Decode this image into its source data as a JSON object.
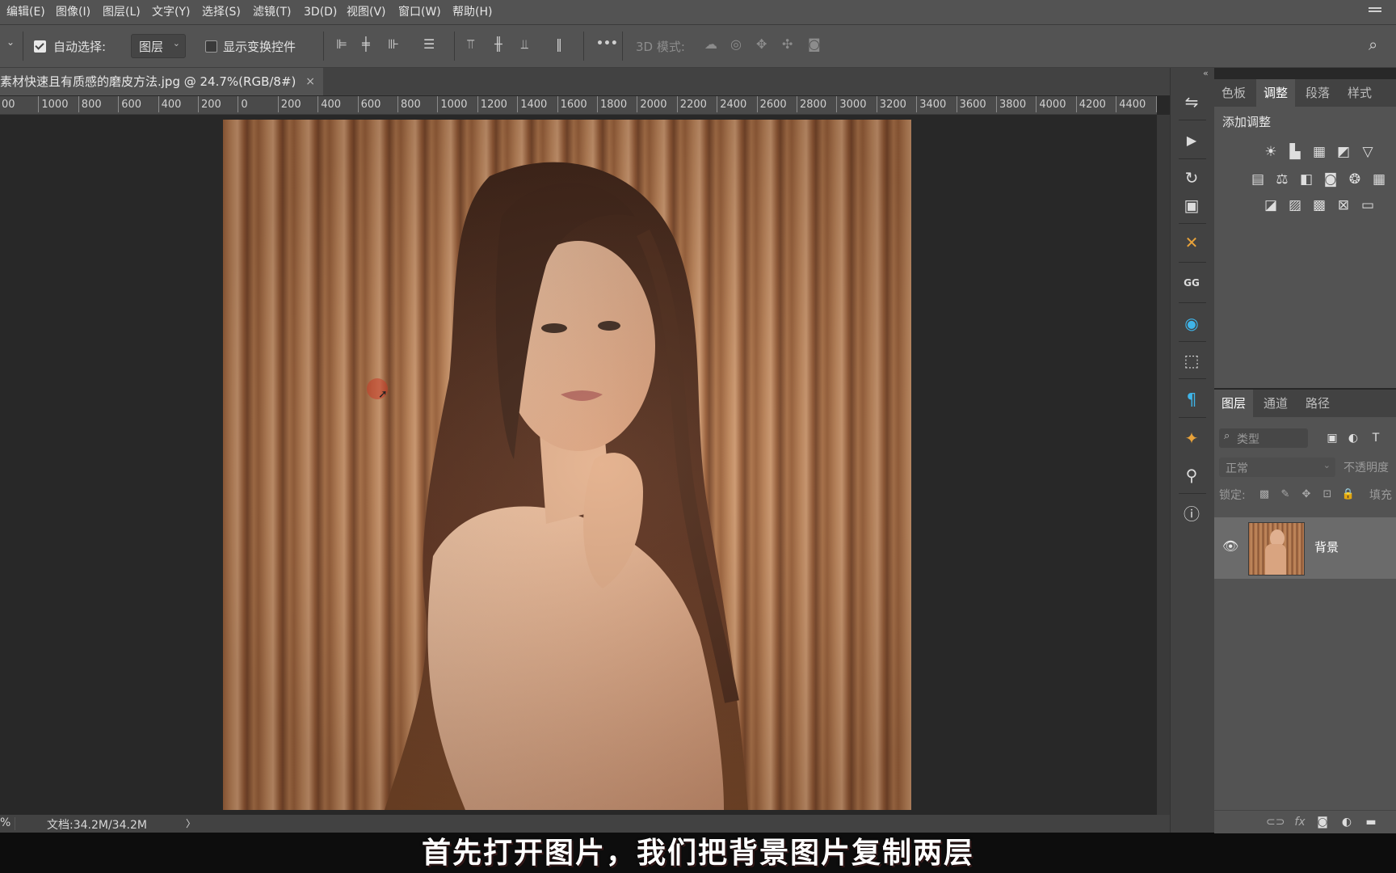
{
  "menu": [
    "编辑(E)",
    "图像(I)",
    "图层(L)",
    "文字(Y)",
    "选择(S)",
    "滤镜(T)",
    "3D(D)",
    "视图(V)",
    "窗口(W)",
    "帮助(H)"
  ],
  "options": {
    "auto_select_label": "自动选择:",
    "auto_select_value": "图层",
    "show_transform_label": "显示变换控件",
    "more_label": "•••",
    "mode3d_label": "3D 模式:"
  },
  "document": {
    "tab_title": "素材快速且有质感的磨皮方法.jpg @ 24.7%(RGB/8#)",
    "close_symbol": "×"
  },
  "ruler": {
    "labels": [
      "00",
      "1000",
      "800",
      "600",
      "400",
      "200",
      "0",
      "200",
      "400",
      "600",
      "800",
      "1000",
      "1200",
      "1400",
      "1600",
      "1800",
      "2000",
      "2200",
      "2400",
      "2600",
      "2800",
      "3000",
      "3200",
      "3400",
      "3600",
      "3800",
      "4000",
      "4200",
      "4400",
      "46"
    ]
  },
  "status": {
    "zoom_fragment": "%",
    "doc_size": "文档:34.2M/34.2M",
    "arrow": "〉"
  },
  "caption": "首先打开图片，我们把背景图片复制两层",
  "adjustments": {
    "tabs": [
      "色板",
      "调整",
      "段落",
      "样式"
    ],
    "active_tab": "调整",
    "add_label": "添加调整"
  },
  "layers": {
    "tabs": [
      "图层",
      "通道",
      "路径"
    ],
    "active_tab": "图层",
    "filter_placeholder": "类型",
    "blend_mode": "正常",
    "opacity_label": "不透明度",
    "lock_label": "锁定:",
    "fill_label": "填充",
    "items": [
      {
        "name": "背景",
        "visible": true
      }
    ]
  },
  "colors": {
    "accent": "#ffffff",
    "caption_bg": "#0d0d0d",
    "panel": "#535353"
  }
}
